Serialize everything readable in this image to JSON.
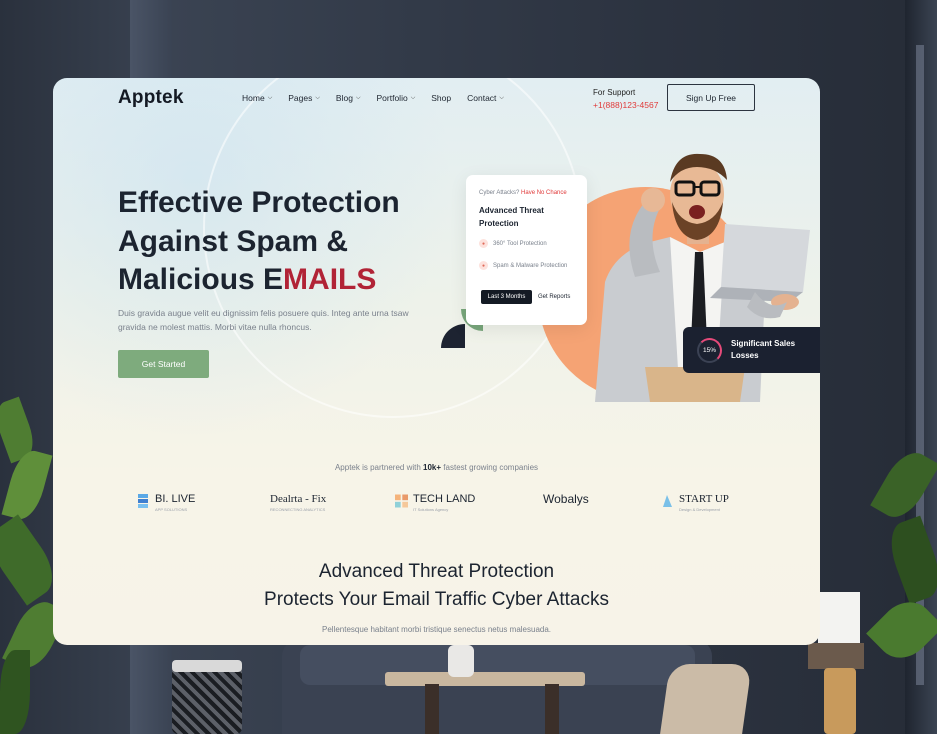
{
  "header": {
    "logo": "Apptek",
    "nav": [
      {
        "label": "Home",
        "has_dropdown": true
      },
      {
        "label": "Pages",
        "has_dropdown": true
      },
      {
        "label": "Blog",
        "has_dropdown": true
      },
      {
        "label": "Portfolio",
        "has_dropdown": true
      },
      {
        "label": "Shop",
        "has_dropdown": false
      },
      {
        "label": "Contact",
        "has_dropdown": true
      }
    ],
    "support_label": "For Support",
    "support_phone": "+1(888)123-4567",
    "signup_label": "Sign Up Free"
  },
  "hero": {
    "title_line1": "Effective Protection",
    "title_line2": "Against Spam &",
    "title_line3_prefix": "Malicious E",
    "title_line3_accent": "MAILS",
    "description": "Duis gravida augue velit eu dignissim felis posuere quis. Integ ante urna tsaw gravida ne molest mattis. Morbi vitae nulla rhoncus.",
    "cta_label": "Get Started"
  },
  "info_card": {
    "kicker": "Cyber Attacks?",
    "kicker_accent": "Have No Chance",
    "title": "Advanced Threat Protection",
    "features": [
      "360° Tool Protection",
      "Spam & Malware Protection"
    ],
    "primary_button": "Last 3 Months",
    "secondary_button": "Get Reports"
  },
  "stat_badge": {
    "value": "15%",
    "label": "Significant Sales Losses"
  },
  "partners": {
    "caption_prefix": "Apptek is partnered with",
    "caption_bold": "10k+",
    "caption_suffix": "fastest growing companies",
    "items": [
      {
        "name": "BI. LIVE",
        "sub": "APP SOLUTIONS"
      },
      {
        "name": "Dealrta - Fix",
        "sub": "RECONNECTING ANALYTICS"
      },
      {
        "name": "TECH LAND",
        "sub": "IT Solutions Agency"
      },
      {
        "name": "Wobalys",
        "sub": ""
      },
      {
        "name": "START UP",
        "sub": "Design & Development"
      }
    ]
  },
  "section2": {
    "title_line1": "Advanced Threat Protection",
    "title_line2": "Protects Your Email Traffic Cyber Attacks",
    "description": "Pellentesque habitant morbi tristique senectus netus malesuada."
  },
  "colors": {
    "accent_red": "#b12336",
    "cta_green": "#7eab7d",
    "dark": "#1c2430",
    "orange": "#f5a374"
  },
  "icons": [
    "chevron-down-icon",
    "shield-icon",
    "malware-icon"
  ]
}
